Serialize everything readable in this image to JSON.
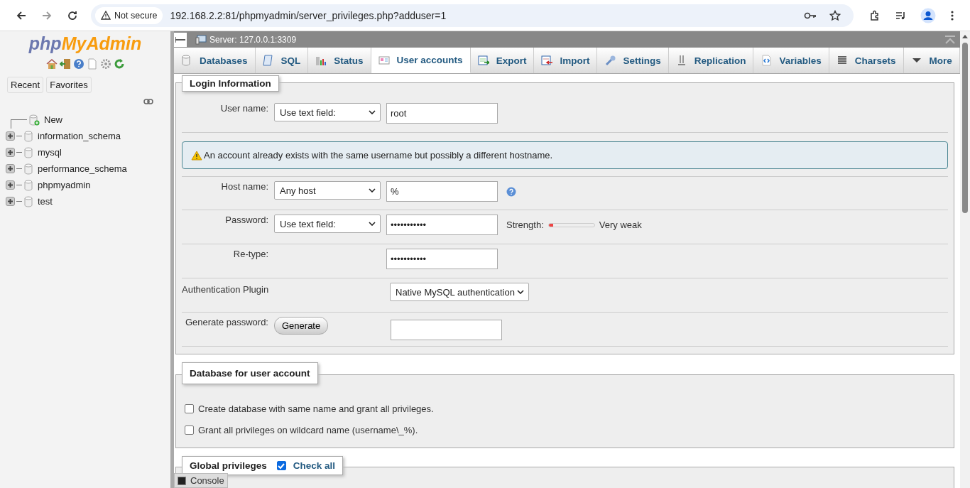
{
  "browser": {
    "security": "Not secure",
    "url": "192.168.2.2:81/phpmyadmin/server_privileges.php?adduser=1"
  },
  "sidebar": {
    "logo": {
      "part_1": "php",
      "part_2": "MyAdmin"
    },
    "buttons": [
      "Recent",
      "Favorites"
    ],
    "tree": [
      {
        "kind": "new",
        "label": "New"
      },
      {
        "kind": "db",
        "label": "information_schema",
        "expanded": false
      },
      {
        "kind": "db",
        "label": "mysql",
        "expanded": false
      },
      {
        "kind": "db",
        "label": "performance_schema",
        "expanded": false
      },
      {
        "kind": "db",
        "label": "phpmyadmin",
        "expanded": false
      },
      {
        "kind": "db",
        "label": "test",
        "expanded": false
      }
    ]
  },
  "server_bar": {
    "title": "Server: 127.0.0.1:3309"
  },
  "tabs": [
    {
      "label": "Databases",
      "selected": false
    },
    {
      "label": "SQL",
      "selected": false
    },
    {
      "label": "Status",
      "selected": false
    },
    {
      "label": "User accounts",
      "selected": true
    },
    {
      "label": "Export",
      "selected": false
    },
    {
      "label": "Import",
      "selected": false
    },
    {
      "label": "Settings",
      "selected": false
    },
    {
      "label": "Replication",
      "selected": false
    },
    {
      "label": "Variables",
      "selected": false
    },
    {
      "label": "Charsets",
      "selected": false
    },
    {
      "label": "More",
      "selected": false
    }
  ],
  "login_information": {
    "legend": "Login Information",
    "rows": [
      {
        "kind": "field",
        "label": "User name:",
        "select": "Use text field:",
        "value": "root"
      },
      {
        "kind": "notice",
        "text": "An account already exists with the same username but possibly a different hostname."
      },
      {
        "kind": "field",
        "label": "Host name:",
        "select": "Any host",
        "value": "%",
        "help": true
      },
      {
        "kind": "field",
        "label": "Password:",
        "select": "Use text field:",
        "value": "•••••••••••",
        "strength": {
          "label": "Strength:",
          "level": 0.1,
          "reading": "Very weak"
        }
      },
      {
        "kind": "field",
        "label": "Re-type:",
        "value": "•••••••••••"
      },
      {
        "kind": "plugin",
        "label": "Authentication Plugin",
        "select": "Native MySQL authentication"
      },
      {
        "kind": "generate",
        "label": "Generate password:",
        "button": "Generate"
      }
    ]
  },
  "database_for_user": {
    "legend": "Database for user account",
    "options": [
      {
        "label": "Create database with same name and grant all privileges.",
        "checked": false
      },
      {
        "label": "Grant all privileges on wildcard name (username\\_%).",
        "checked": false
      }
    ]
  },
  "global_privileges": {
    "legend": "Global privileges",
    "check_all": {
      "label": "Check all",
      "checked": true
    }
  },
  "console": {
    "label": "Console"
  }
}
